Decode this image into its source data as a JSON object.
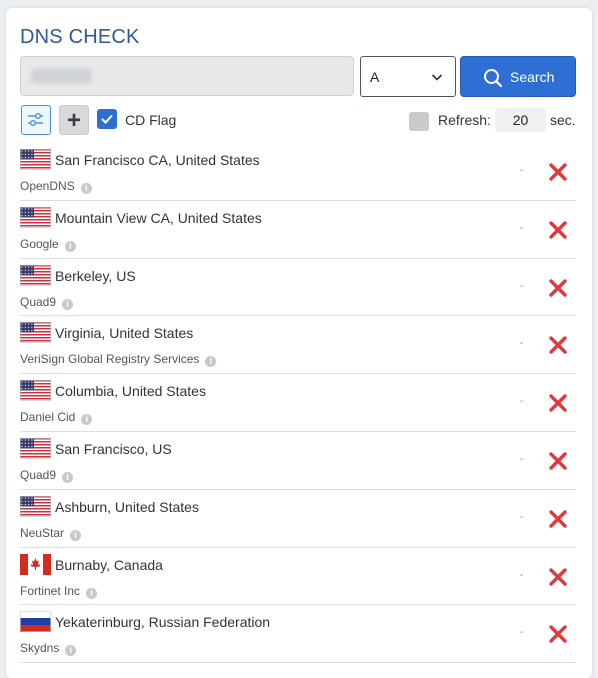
{
  "app": {
    "title": "DNS CHECK"
  },
  "search": {
    "placeholder": "",
    "value": ""
  },
  "record_type": {
    "selected": "A"
  },
  "search_button": {
    "label": "Search"
  },
  "options": {
    "cd_flag_label": "CD Flag",
    "cd_flag_checked": true,
    "refresh_checked": false,
    "refresh_label": "Refresh:",
    "refresh_value": "20",
    "refresh_unit": "sec."
  },
  "colors": {
    "brand": "#2d5b96",
    "primary": "#2f6fd3",
    "error": "#e0383d"
  },
  "servers": [
    {
      "flag": "us",
      "location": "San Francisco CA, United States",
      "provider": "OpenDNS",
      "result": "-",
      "status": "error"
    },
    {
      "flag": "us",
      "location": "Mountain View CA, United States",
      "provider": "Google",
      "result": "-",
      "status": "error"
    },
    {
      "flag": "us",
      "location": "Berkeley, US",
      "provider": "Quad9",
      "result": "-",
      "status": "error"
    },
    {
      "flag": "us",
      "location": "Virginia, United States",
      "provider": "VeriSign Global Registry Services",
      "result": "-",
      "status": "error"
    },
    {
      "flag": "us",
      "location": "Columbia, United States",
      "provider": "Daniel Cid",
      "result": "-",
      "status": "error"
    },
    {
      "flag": "us",
      "location": "San Francisco, US",
      "provider": "Quad9",
      "result": "-",
      "status": "error"
    },
    {
      "flag": "us",
      "location": "Ashburn, United States",
      "provider": "NeuStar",
      "result": "-",
      "status": "error"
    },
    {
      "flag": "ca",
      "location": "Burnaby, Canada",
      "provider": "Fortinet Inc",
      "result": "-",
      "status": "error"
    },
    {
      "flag": "ru",
      "location": "Yekaterinburg, Russian Federation",
      "provider": "Skydns",
      "result": "-",
      "status": "error"
    }
  ]
}
